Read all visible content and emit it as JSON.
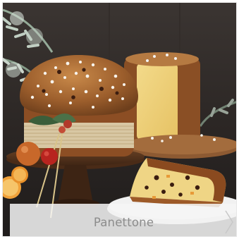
{
  "caption": {
    "label": "Panettone"
  },
  "image": {
    "subject": "panettone-photo"
  },
  "icons": {
    "next": "chevron-right-icon"
  }
}
